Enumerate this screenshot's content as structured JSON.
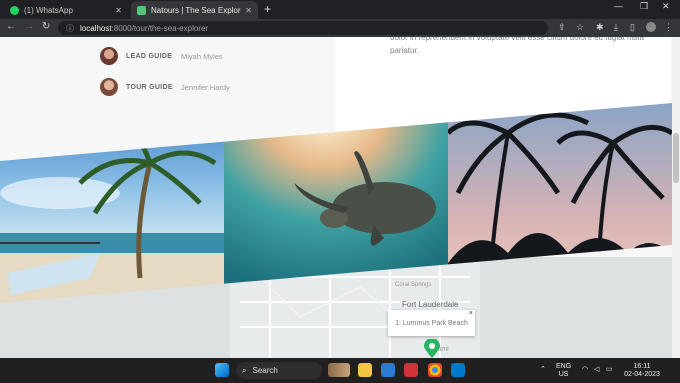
{
  "browser": {
    "tabs": [
      {
        "title": "(1) WhatsApp",
        "active": false,
        "favicon_color": "#25d366"
      },
      {
        "title": "Natours | The Sea Explorer Tour",
        "active": true,
        "favicon_color": "#55c57a"
      }
    ],
    "address": {
      "host": "localhost",
      "path": ":8000/tour/the-sea-explorer"
    }
  },
  "page": {
    "description": "dolor in reprehenderit in voluptate velit esse cillum dolore eu fugiat nulla pariatur.",
    "guides": [
      {
        "role": "LEAD GUIDE",
        "name": "Miyah Myles"
      },
      {
        "role": "TOUR GUIDE",
        "name": "Jennifer Hardy"
      }
    ],
    "images": [
      "beach-palm-photo",
      "sea-turtle-photo",
      "palm-sunset-photo"
    ]
  },
  "map": {
    "labels": {
      "coral": "Coral Springs",
      "fort": "Fort Lauderdale",
      "miami": "Miami"
    },
    "popup": "1: Lummus Park Beach",
    "popup_close": "×"
  },
  "taskbar": {
    "search": "Search",
    "lang": "ENG",
    "region": "US",
    "time": "16:11",
    "date": "02-04-2023"
  }
}
